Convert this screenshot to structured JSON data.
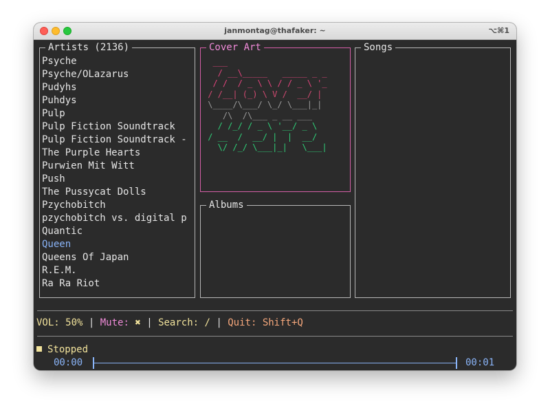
{
  "window": {
    "title": "janmontag@thafaker: ~",
    "shortcut": "⌥⌘1"
  },
  "panels": {
    "artists": {
      "title": "Artists (2136)",
      "items": [
        "Psyche",
        "Psyche/OLazarus",
        "Pudyhs",
        "Puhdys",
        "Pulp",
        "Pulp Fiction Soundtrack",
        "Pulp Fiction Soundtrack -",
        "The Purple Hearts",
        "Purwien Mit Witt",
        "Push",
        "The Pussycat Dolls",
        "Pzychobitch",
        "pzychobitch vs. digital p",
        "Quantic",
        "Queen",
        "Queens Of Japan",
        "R.E.M.",
        "Ra Ra Riot"
      ],
      "selected_item": "Queen"
    },
    "cover_art": {
      "title": "Cover Art",
      "lines": [
        "  ___",
        "   / __\\_____   _____ _ _",
        "  / /  / _ \\ \\ / / _ \\ '_",
        " / /__| (_) \\ V /  __/ |",
        " \\____/\\___/ \\_/ \\___|_|",
        "    /\\  /\\___ _ __ ___",
        "   / /_/ / _ \\ '__/ _ \\",
        " / __  /  __/ |  |  __/",
        "   \\/ /_/ \\___|_|   \\___|"
      ],
      "line_colors": [
        "#e0447c",
        "#e0447c",
        "#e0447c",
        "#d24a72",
        "#9a9a9a",
        "#9a9a9a",
        "#2fcf78",
        "#2fcf78",
        "#2fcf78"
      ]
    },
    "albums": {
      "title": "Albums"
    },
    "songs": {
      "title": "Songs"
    }
  },
  "status_bar": {
    "vol_label": "VOL: ",
    "vol_value": "50%",
    "sep1": " | ",
    "mute_label": "Mute: ",
    "mute_value": "✖",
    "sep2": " | ",
    "search_label": "Search: ",
    "search_value": "/",
    "sep3": " | ",
    "quit_label": "Quit: ",
    "quit_value": "Shift+Q"
  },
  "player": {
    "state": "Stopped",
    "elapsed": "00:00",
    "total": "00:01",
    "progress": 0
  },
  "colors": {
    "terminal_bg": "#2b2b2b",
    "cover_art_border": "#d55fa8",
    "cover_art_title": "#f08bd9",
    "selected_artist": "#8ab4f8",
    "status_yellow": "#f2e39c",
    "status_pink": "#f08bd9",
    "status_orange": "#f7a87c",
    "timeline_blue": "#8ab4f8"
  }
}
